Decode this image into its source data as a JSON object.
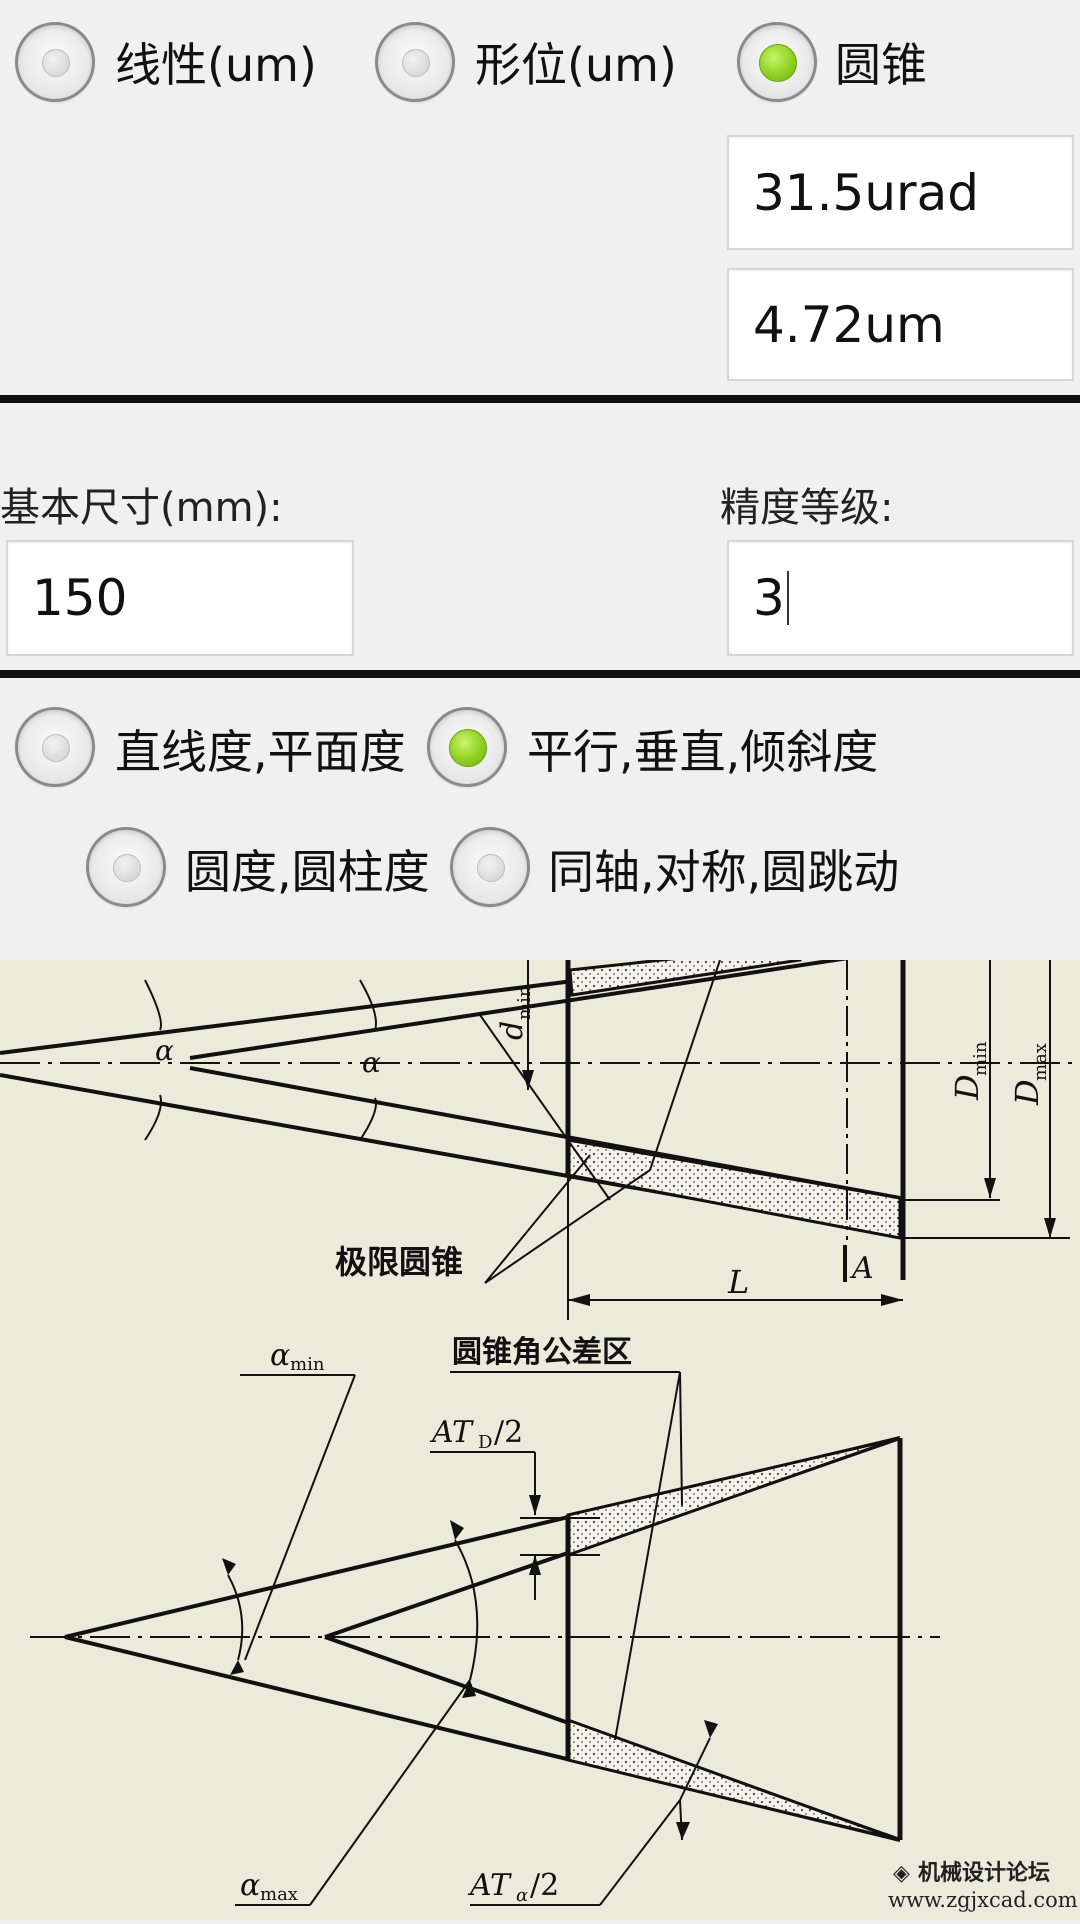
{
  "mode_options": [
    {
      "label": "线性(um)",
      "checked": false
    },
    {
      "label": "形位(um)",
      "checked": false
    },
    {
      "label": "圆锥",
      "checked": true
    }
  ],
  "results": {
    "angle_value": "31.5urad",
    "length_value": "4.72um"
  },
  "params": {
    "basic_size_label": "基本尺寸(mm):",
    "basic_size_value": "150",
    "grade_label": "精度等级:",
    "grade_value": "3"
  },
  "tolerance_types": [
    {
      "label": "直线度,平面度",
      "checked": false
    },
    {
      "label": "平行,垂直,倾斜度",
      "checked": true
    },
    {
      "label": "圆度,圆柱度",
      "checked": false
    },
    {
      "label": "同轴,对称,圆跳动",
      "checked": false
    }
  ],
  "diagram": {
    "alpha": "α",
    "d_min": "d",
    "d_min_sub": "min",
    "D_min": "D",
    "D_min_sub": "min",
    "D_max": "D",
    "D_max_sub": "max",
    "limit_cones": "极限圆锥",
    "L": "L",
    "A": "A",
    "alpha_min": "α",
    "alpha_min_sub": "min",
    "cone_angle_zone": "圆锥角公差区",
    "ATD": "AT",
    "ATD_sub": "D",
    "ATD_suffix": "/2",
    "alpha_max": "α",
    "alpha_max_sub": "max",
    "ATa": "AT",
    "ATa_sub": "α",
    "ATa_suffix": "/2",
    "watermark_title": "机械设计论坛",
    "watermark_url": "www.zgjxcad.com"
  }
}
